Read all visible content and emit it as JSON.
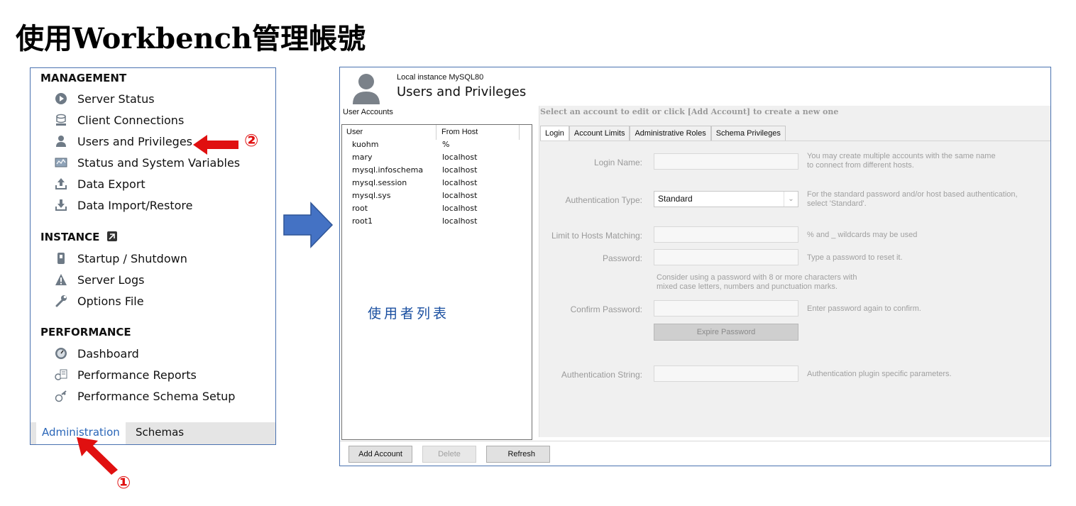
{
  "slide_title": "使用Workbench管理帳號",
  "navigator": {
    "sections": [
      {
        "title": "MANAGEMENT",
        "items": [
          {
            "label": "Server Status",
            "icon": "server-status-icon"
          },
          {
            "label": "Client Connections",
            "icon": "client-connections-icon"
          },
          {
            "label": "Users and Privileges",
            "icon": "user-icon"
          },
          {
            "label": "Status and System Variables",
            "icon": "variables-icon"
          },
          {
            "label": "Data Export",
            "icon": "export-icon"
          },
          {
            "label": "Data Import/Restore",
            "icon": "import-icon"
          }
        ]
      },
      {
        "title": "INSTANCE",
        "icon": "instance-icon",
        "items": [
          {
            "label": "Startup / Shutdown",
            "icon": "startup-icon"
          },
          {
            "label": "Server Logs",
            "icon": "warning-icon"
          },
          {
            "label": "Options File",
            "icon": "wrench-icon"
          }
        ]
      },
      {
        "title": "PERFORMANCE",
        "items": [
          {
            "label": "Dashboard",
            "icon": "dashboard-icon"
          },
          {
            "label": "Performance Reports",
            "icon": "reports-icon"
          },
          {
            "label": "Performance Schema Setup",
            "icon": "schema-setup-icon"
          }
        ]
      }
    ],
    "tabs": {
      "administration": "Administration",
      "schemas": "Schemas"
    }
  },
  "annotations": {
    "step1": "①",
    "step2": "②",
    "user_list_caption": "使用者列表"
  },
  "colors": {
    "arrow_red": "#e01010",
    "arrow_blue": "#4472c4",
    "link_blue": "#2a66b8"
  },
  "main": {
    "instance": "Local instance MySQL80",
    "title": "Users and Privileges",
    "user_accounts_label": "User Accounts",
    "columns": {
      "user": "User",
      "from_host": "From Host"
    },
    "accounts": [
      {
        "user": "kuohm",
        "host": "%"
      },
      {
        "user": "mary",
        "host": "localhost"
      },
      {
        "user": "mysql.infoschema",
        "host": "localhost"
      },
      {
        "user": "mysql.session",
        "host": "localhost"
      },
      {
        "user": "mysql.sys",
        "host": "localhost"
      },
      {
        "user": "root",
        "host": "localhost"
      },
      {
        "user": "root1",
        "host": "localhost"
      }
    ],
    "select_message": "Select an account to edit or click [Add Account] to create a new one",
    "tabs": [
      "Login",
      "Account Limits",
      "Administrative Roles",
      "Schema Privileges"
    ],
    "form": {
      "login_name_label": "Login Name:",
      "login_name_hint_1": "You may create multiple accounts with the same name",
      "login_name_hint_2": "to connect from different hosts.",
      "auth_type_label": "Authentication Type:",
      "auth_type_value": "Standard",
      "auth_type_hint_1": "For the standard password and/or host based authentication,",
      "auth_type_hint_2": "select 'Standard'.",
      "hosts_label": "Limit to Hosts Matching:",
      "hosts_hint": "% and _ wildcards may be used",
      "password_label": "Password:",
      "password_hint": "Type a password to reset it.",
      "password_note_1": "Consider using a password with 8 or more characters with",
      "password_note_2": "mixed case letters, numbers and punctuation marks.",
      "confirm_label": "Confirm Password:",
      "confirm_hint": "Enter password again to confirm.",
      "expire_button": "Expire Password",
      "auth_string_label": "Authentication String:",
      "auth_string_hint": "Authentication plugin specific parameters."
    },
    "buttons": {
      "add": "Add Account",
      "delete": "Delete",
      "refresh": "Refresh"
    }
  }
}
